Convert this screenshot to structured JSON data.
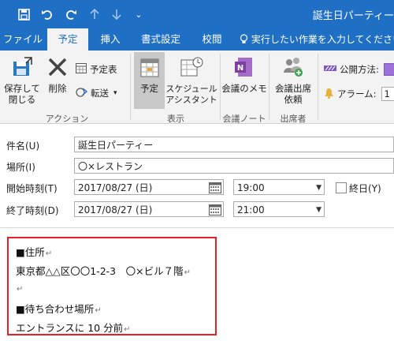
{
  "window": {
    "title": "誕生日パーティー"
  },
  "quick_access": {
    "save_icon": "save-icon",
    "undo_icon": "undo-icon",
    "redo_icon": "redo-icon",
    "up_icon": "arrow-up-icon",
    "down_icon": "arrow-down-icon",
    "customize_glyph": "⌄"
  },
  "tabs": [
    {
      "label": "ファイル",
      "active": false
    },
    {
      "label": "予定",
      "active": true
    },
    {
      "label": "挿入",
      "active": false
    },
    {
      "label": "書式設定",
      "active": false
    },
    {
      "label": "校閲",
      "active": false
    }
  ],
  "tell_me": {
    "glyph": "💡",
    "text": "実行したい作業を入力してください"
  },
  "ribbon": {
    "actions": {
      "save_close_line1": "保存して",
      "save_close_line2": "閉じる",
      "delete": "削除",
      "calendar": "予定表",
      "forward": "転送",
      "group": "アクション"
    },
    "show": {
      "appointment": "予定",
      "schedule_line1": "スケジュール",
      "schedule_line2": "アシスタント",
      "group": "表示"
    },
    "meeting_notes": {
      "notes": "会議のメモ",
      "group": "会議ノート"
    },
    "attendees": {
      "request_line1": "会議出席",
      "request_line2": "依頼",
      "group": "出席者"
    },
    "options": {
      "show_as_label": "公開方法:",
      "reminder_label": "アラーム:",
      "reminder_value": "1"
    }
  },
  "form": {
    "subject_label": "件名(U)",
    "subject_value": "誕生日パーティー",
    "location_label": "場所(I)",
    "location_value": "〇×レストラン",
    "start_label": "開始時刻(T)",
    "start_date": "2017/08/27 (日)",
    "start_time": "19:00",
    "allday_label": "終日(Y)",
    "end_label": "終了時刻(D)",
    "end_date": "2017/08/27 (日)",
    "end_time": "21:00"
  },
  "body": {
    "lines": [
      "■住所",
      "東京都△△区〇〇1-2-3　〇×ビル７階",
      "",
      "■待ち合わせ場所",
      "エントランスに 10 分前"
    ],
    "return_mark": "↵"
  },
  "colors": {
    "accent": "#1f6fc5",
    "highlight": "#e8202a",
    "onenote": "#7b3fa0"
  }
}
